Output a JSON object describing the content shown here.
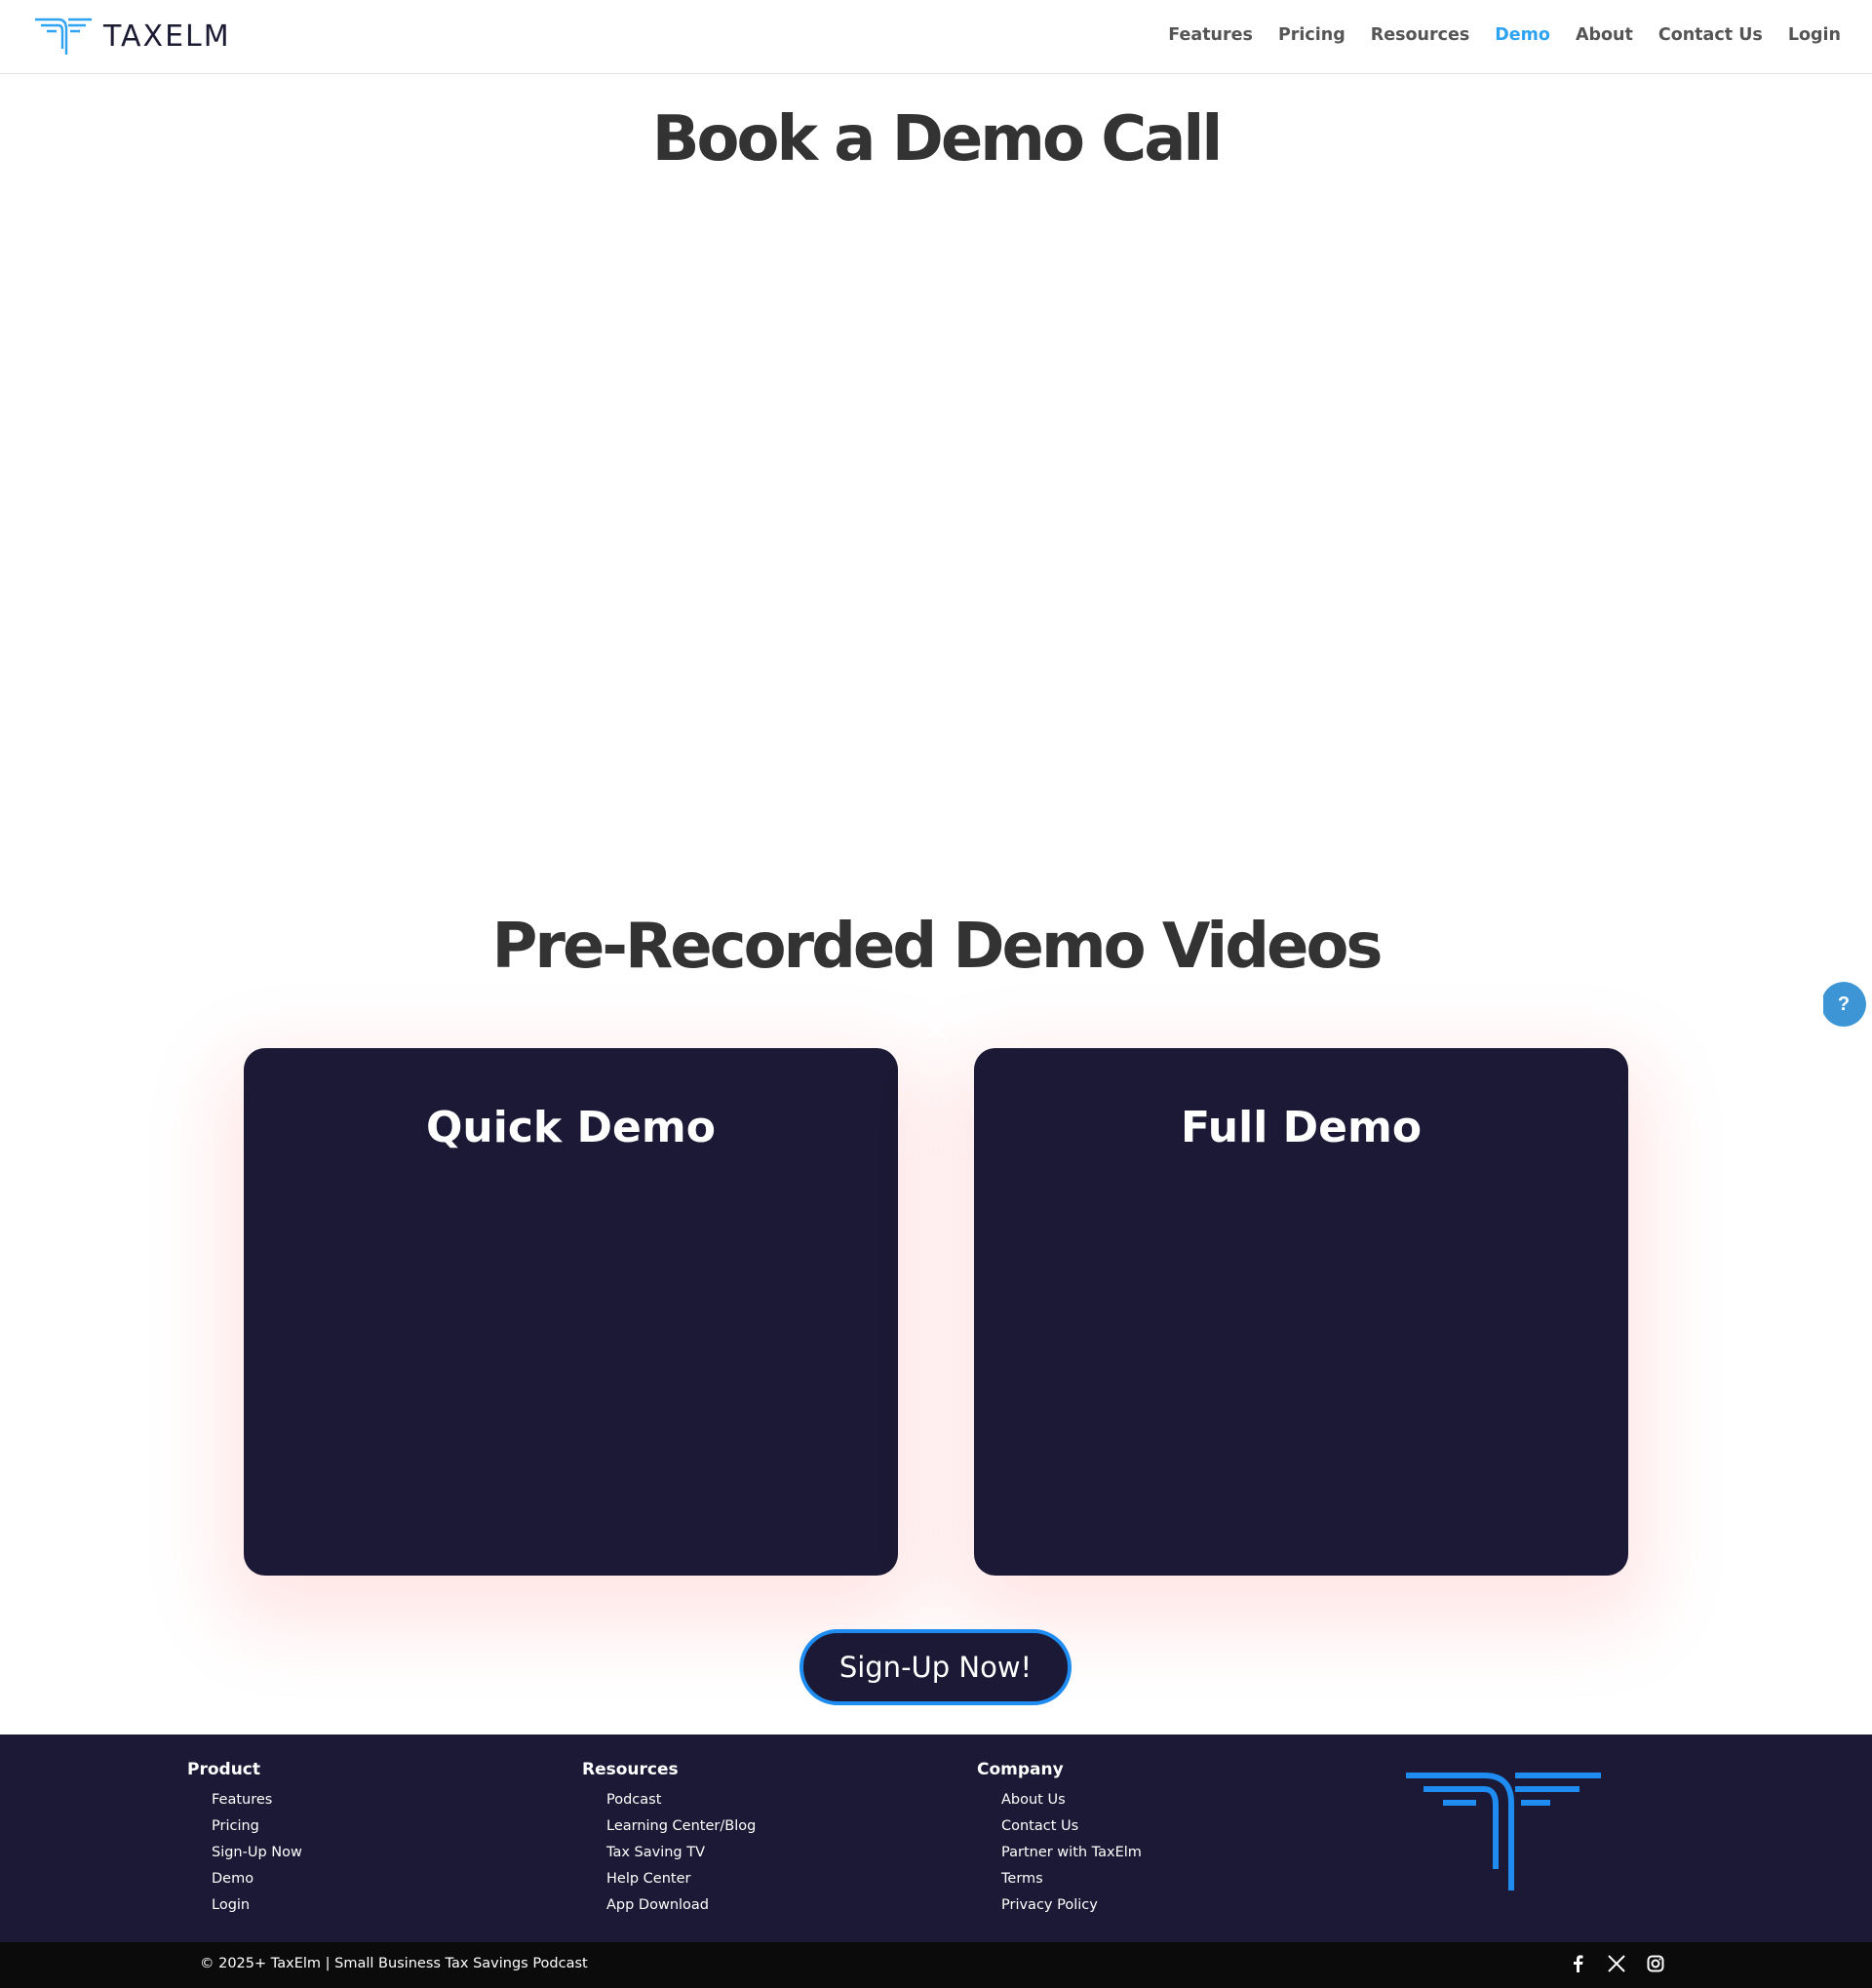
{
  "header": {
    "logo_text": "TAXELM",
    "nav": [
      {
        "label": "Features",
        "active": false
      },
      {
        "label": "Pricing",
        "active": false
      },
      {
        "label": "Resources",
        "active": false
      },
      {
        "label": "Demo",
        "active": true
      },
      {
        "label": "About",
        "active": false
      },
      {
        "label": "Contact Us",
        "active": false
      },
      {
        "label": "Login",
        "active": false
      }
    ]
  },
  "main": {
    "book_heading": "Book a Demo Call",
    "videos_heading": "Pre-Recorded Demo Videos",
    "cards": [
      {
        "title": "Quick Demo"
      },
      {
        "title": "Full Demo"
      }
    ],
    "cta_label": "Sign-Up Now!"
  },
  "footer": {
    "columns": [
      {
        "heading": "Product",
        "links": [
          "Features",
          "Pricing",
          "Sign-Up Now",
          "Demo",
          "Login"
        ]
      },
      {
        "heading": "Resources",
        "links": [
          "Podcast",
          "Learning Center/Blog",
          "Tax Saving TV",
          "Help Center",
          "App Download"
        ]
      },
      {
        "heading": "Company",
        "links": [
          "About Us",
          "Contact Us",
          "Partner with TaxElm",
          "Terms",
          "Privacy Policy"
        ]
      }
    ],
    "copyright": "© 2025+ TaxElm | Small Business Tax Savings Podcast",
    "socials": [
      "facebook-icon",
      "x-icon",
      "instagram-icon"
    ]
  },
  "colors": {
    "accent": "#2ea3f2",
    "navy": "#1b1935",
    "cta_border": "#1e8cf0"
  }
}
